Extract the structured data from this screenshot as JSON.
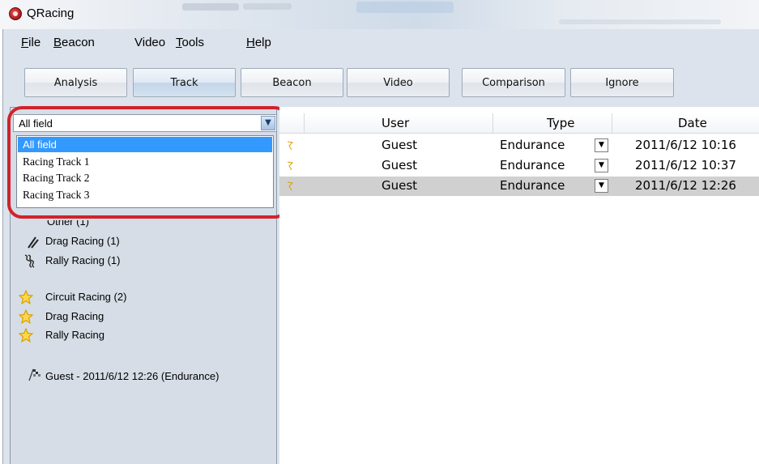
{
  "window": {
    "title": "QRacing"
  },
  "menu": [
    {
      "pre": "",
      "accel": "F",
      "post": "ile"
    },
    {
      "pre": "",
      "accel": "B",
      "post": "eacon"
    },
    {
      "pre": "Video",
      "accel": "",
      "post": ""
    },
    {
      "pre": "",
      "accel": "T",
      "post": "ools"
    },
    {
      "pre": "",
      "accel": "H",
      "post": "elp"
    }
  ],
  "toolbar": {
    "tabs": [
      "Analysis",
      "Track",
      "Beacon",
      "Video",
      "Comparison",
      "Ignore"
    ],
    "active": "Track"
  },
  "filter": {
    "value": "All field",
    "options": [
      "All field",
      "Racing Track 1",
      "Racing Track 2",
      "Racing Track 3"
    ],
    "selected": "All field"
  },
  "tree": {
    "partial_item": "Other (1)",
    "categories": [
      "Drag Racing (1)",
      "Rally Racing (1)"
    ],
    "favorites": [
      "Circuit Racing (2)",
      "Drag Racing",
      "Rally Racing"
    ],
    "session": "Guest - 2011/6/12 12:26 (Endurance)"
  },
  "table": {
    "columns": [
      "User",
      "Type",
      "Date"
    ],
    "rows": [
      {
        "user": "Guest",
        "type": "Endurance",
        "date": "2011/6/12 10:16",
        "selected": false
      },
      {
        "user": "Guest",
        "type": "Endurance",
        "date": "2011/6/12 10:37",
        "selected": false
      },
      {
        "user": "Guest",
        "type": "Endurance",
        "date": "2011/6/12 12:26",
        "selected": true
      }
    ]
  },
  "icons": {
    "app": "qracing-logo-icon",
    "combo_arrow": "chevron-down-icon",
    "star": "star-icon",
    "drag": "drag-racing-icon",
    "rally": "rally-racing-icon",
    "session": "checkered-flag-icon"
  },
  "colors": {
    "highlight": "#d1222b",
    "selection": "#3399ff",
    "star_fill": "#ffd84a",
    "star_stroke": "#d9a000"
  }
}
